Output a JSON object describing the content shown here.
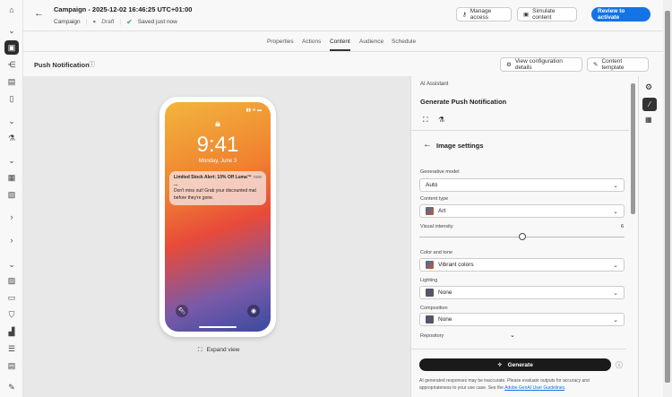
{
  "header": {
    "title": "Campaign - 2025-12-02 16:46:25 UTC+01:00",
    "type": "Campaign",
    "status": "Draft",
    "saved": "Saved just now",
    "manage_access": "Manage access",
    "simulate": "Simulate content",
    "review": "Review to activate"
  },
  "tabs": [
    "Properties",
    "Actions",
    "Content",
    "Audience",
    "Schedule"
  ],
  "section": {
    "title": "Push Notification",
    "view_config": "View configuration details",
    "content_template": "Content template"
  },
  "phone": {
    "time": "9:41",
    "date": "Monday, June 3",
    "notif_title": "Limited Stock Alert: 10% Off Luma™ ...",
    "notif_time": "now",
    "notif_body": "Don't miss out! Grab your discounted mat before they're gone."
  },
  "expand_view": "Expand view",
  "panel": {
    "kicker": "AI Assistant",
    "title": "Generate Push Notification",
    "sub_title": "Image settings",
    "generative_model_label": "Generative model",
    "generative_model": "Auto",
    "content_type_label": "Content type",
    "content_type": "Art",
    "visual_intensity_label": "Visual intensity",
    "visual_intensity": "6",
    "visual_intensity_fraction": 0.5,
    "color_tone_label": "Color and tone",
    "color_tone": "Vibrant colors",
    "lighting_label": "Lighting",
    "lighting": "None",
    "composition_label": "Composition",
    "composition": "None",
    "repository_label": "Repository",
    "generate": "Generate",
    "disclaimer": "AI generated responses may be inaccurate. Please evaluate outputs for accuracy and appropriateness to your use case. See the ",
    "disclaimer_link": "Adobe GenAI User Guidelines",
    "disclaimer_end": "."
  }
}
